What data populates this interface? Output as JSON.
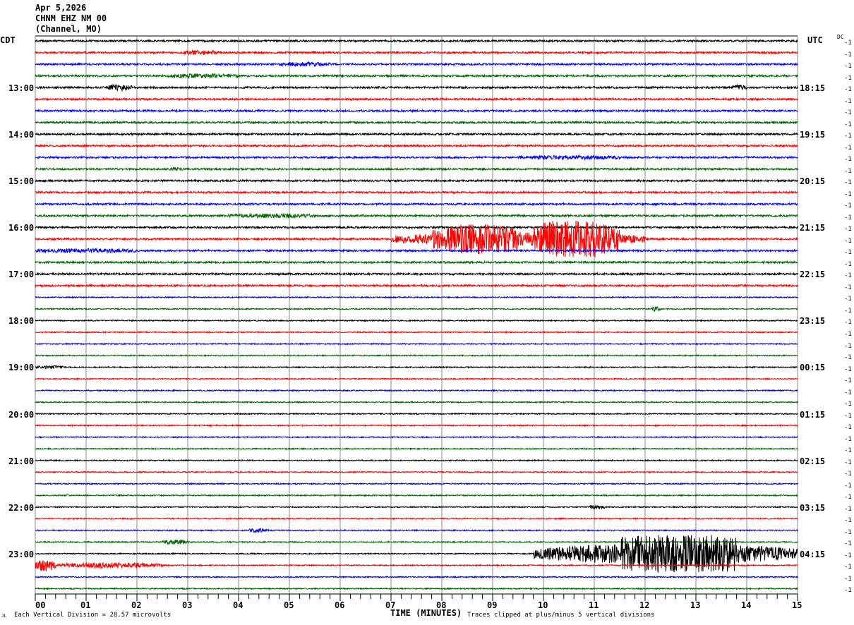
{
  "header": {
    "date": "Apr 5,2026",
    "station": "CHNM EHZ NM 00",
    "location": "(Channel, MO)"
  },
  "chart_data": {
    "type": "line",
    "subtype": "helicorder",
    "xlabel": "TIME (MINUTES)",
    "xlim": [
      0,
      15
    ],
    "x_ticks": [
      "00",
      "01",
      "02",
      "03",
      "04",
      "05",
      "06",
      "07",
      "08",
      "09",
      "10",
      "11",
      "12",
      "13",
      "14",
      "15"
    ],
    "left_timezone": "CDT",
    "right_timezone": "UTC",
    "left_hour_labels": [
      "13:00",
      "14:00",
      "15:00",
      "16:00",
      "17:00",
      "18:00",
      "19:00",
      "20:00",
      "21:00",
      "22:00",
      "23:00"
    ],
    "right_hour_labels": [
      "18:15",
      "19:15",
      "20:15",
      "21:15",
      "22:15",
      "23:15",
      "00:15",
      "01:15",
      "02:15",
      "03:15",
      "04:15"
    ],
    "row_count": 48,
    "trace_colors": [
      "#000000",
      "#ff0000",
      "#0000ff",
      "#006400"
    ],
    "dc_header": "DC",
    "dc_value": "-1",
    "scale_note": "Each Vertical Division =   28.57 microvolts",
    "clip_note": "Traces clipped at plus/minus 5 vertical divisions",
    "corner_mark": "JL",
    "grid": true,
    "events": [
      {
        "row": 1,
        "start": 2.9,
        "end": 3.6,
        "amp": 0.25
      },
      {
        "row": 2,
        "start": 4.8,
        "end": 5.8,
        "amp": 0.2
      },
      {
        "row": 3,
        "start": 2.6,
        "end": 4.0,
        "amp": 0.2
      },
      {
        "row": 4,
        "start": 1.4,
        "end": 1.9,
        "amp": 0.35
      },
      {
        "row": 4,
        "start": 13.7,
        "end": 14.0,
        "amp": 0.3
      },
      {
        "row": 10,
        "start": 9.5,
        "end": 11.5,
        "amp": 0.2
      },
      {
        "row": 11,
        "start": 2.6,
        "end": 2.9,
        "amp": 0.15
      },
      {
        "row": 15,
        "start": 3.8,
        "end": 5.5,
        "amp": 0.2
      },
      {
        "row": 17,
        "start": 7.0,
        "end": 12.0,
        "amp": 1.0
      },
      {
        "row": 17,
        "start": 9.8,
        "end": 11.5,
        "amp": 2.2
      },
      {
        "row": 17,
        "start": 7.8,
        "end": 9.5,
        "amp": 1.3
      },
      {
        "row": 18,
        "start": 0,
        "end": 2,
        "amp": 0.2
      },
      {
        "row": 23,
        "start": 12.1,
        "end": 12.3,
        "amp": 0.3
      },
      {
        "row": 28,
        "start": 0,
        "end": 0.6,
        "amp": 0.2
      },
      {
        "row": 40,
        "start": 10.9,
        "end": 11.2,
        "amp": 0.3
      },
      {
        "row": 42,
        "start": 4.2,
        "end": 4.6,
        "amp": 0.25
      },
      {
        "row": 43,
        "start": 2.5,
        "end": 3.0,
        "amp": 0.3
      },
      {
        "row": 44,
        "start": 9.8,
        "end": 15,
        "amp": 1.6
      },
      {
        "row": 44,
        "start": 11.5,
        "end": 13.8,
        "amp": 3.0
      },
      {
        "row": 45,
        "start": 0,
        "end": 0.4,
        "amp": 0.9
      },
      {
        "row": 45,
        "start": 0.4,
        "end": 2.5,
        "amp": 0.35
      }
    ]
  }
}
